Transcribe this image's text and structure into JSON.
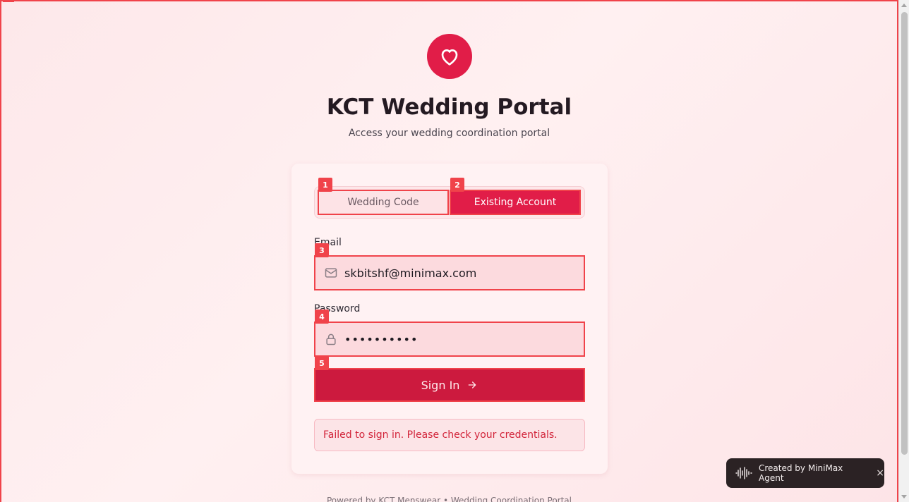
{
  "header": {
    "title": "KCT Wedding Portal",
    "subtitle": "Access your wedding coordination portal",
    "logo_icon": "heart-icon"
  },
  "tabs": [
    {
      "label": "Wedding Code",
      "badge": "1",
      "active": false
    },
    {
      "label": "Existing Account",
      "badge": "2",
      "active": true
    }
  ],
  "form": {
    "email_label": "Email",
    "email_value": "skbitshf@minimax.com",
    "email_badge": "3",
    "password_label": "Password",
    "password_value": "••••••••••",
    "password_badge": "4",
    "signin_label": "Sign In",
    "signin_badge": "5"
  },
  "error": {
    "message": "Failed to sign in. Please check your credentials."
  },
  "footer": {
    "text": "Powered by KCT Menswear • Wedding Coordination Portal"
  },
  "toast": {
    "label": "Created by MiniMax Agent",
    "close": "×"
  },
  "colors": {
    "accent": "#e11d48",
    "button": "#cc1a3e",
    "highlight": "#f0434a",
    "error_text": "#d2243a"
  }
}
